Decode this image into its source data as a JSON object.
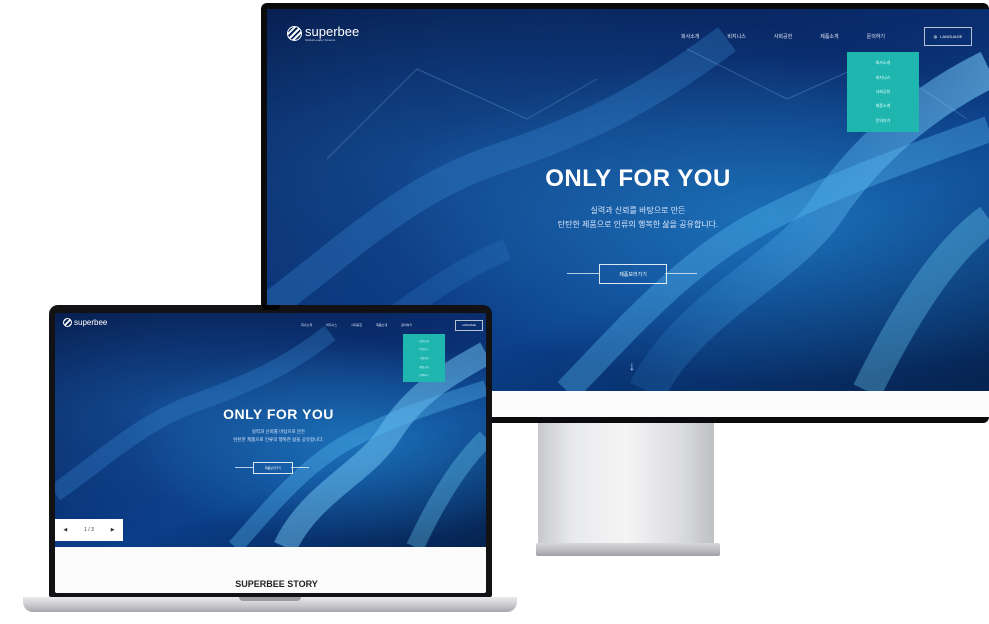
{
  "brand": {
    "name": "superbee",
    "tagline": "Global Leader Science"
  },
  "nav": [
    "회사소개",
    "비지니스",
    "사회공헌",
    "제품소개",
    "문의하기"
  ],
  "language_label": "LANGUAGE",
  "dropdown_items": [
    "회사소개",
    "비지니스",
    "사회공헌",
    "제품소개",
    "문의하기"
  ],
  "hero": {
    "title": "ONLY FOR YOU",
    "line1": "실력과 신뢰를 바탕으로 만든",
    "line2": "탄탄한 제품으로 인류의 행복한 삶을 공유합니다.",
    "cta": "제품보러가기",
    "scroll_glyph": "↓"
  },
  "laptop_extras": {
    "story_title": "SUPERBEE STORY",
    "pager": {
      "prev": "◀",
      "status": "1 / 3",
      "next": "▶"
    }
  },
  "colors": {
    "accent": "#1fb6b0",
    "hero_dark": "#061a4a",
    "hero_blue": "#0b3f8a"
  }
}
